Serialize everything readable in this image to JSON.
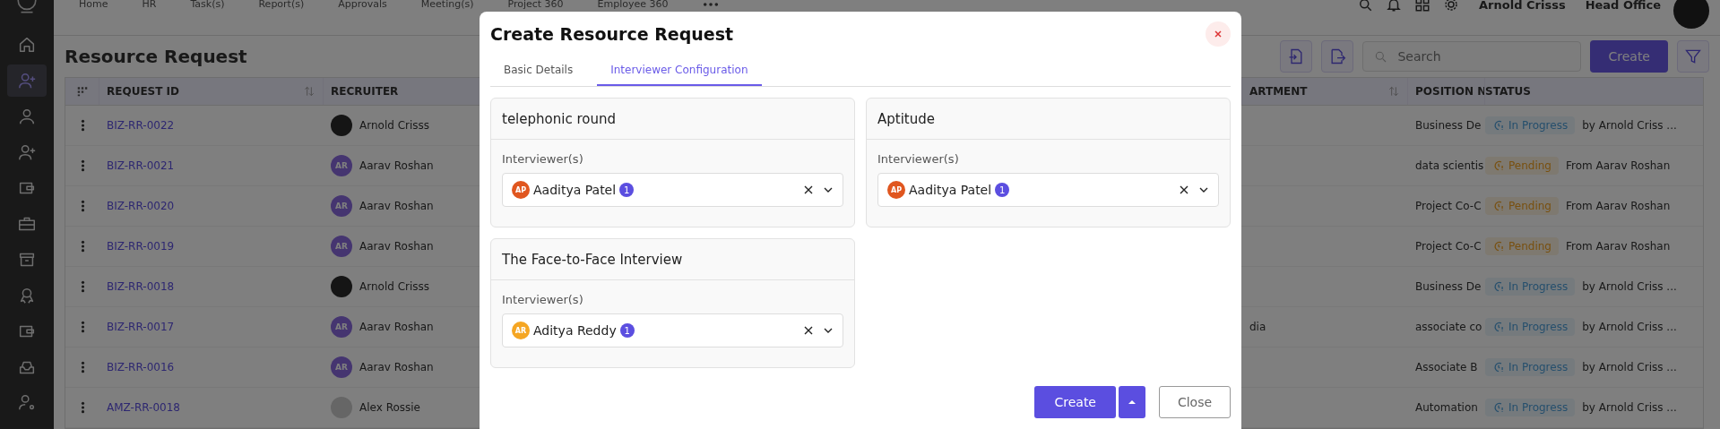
{
  "top_nav": {
    "items": [
      "Home",
      "HR",
      "Task(s)",
      "Report(s)",
      "Approvals",
      "Meeting(s)",
      "Project 360",
      "Employee 360"
    ]
  },
  "user": {
    "name": "Arnold Crisss",
    "office": "Head Office"
  },
  "sidebar": {
    "items": [
      {
        "kind": "home",
        "selected": false
      },
      {
        "kind": "user-plus",
        "selected": true
      },
      {
        "kind": "user",
        "selected": false
      },
      {
        "kind": "user-plus",
        "selected": false
      },
      {
        "kind": "wallet",
        "selected": false
      },
      {
        "kind": "briefcase",
        "selected": false
      },
      {
        "kind": "archive",
        "selected": false
      },
      {
        "kind": "award",
        "selected": false
      },
      {
        "kind": "wallet",
        "selected": false
      },
      {
        "kind": "tray",
        "selected": false
      },
      {
        "kind": "user-gear",
        "selected": false
      }
    ]
  },
  "page": {
    "title": "Resource Request",
    "search": {
      "placeholder": "Search"
    },
    "create_button": "Create"
  },
  "table": {
    "columns": [
      "REQUEST ID",
      "RECRUITER",
      "ARTMENT",
      "POSITION N",
      "STATUS"
    ],
    "rows": [
      {
        "request_id": "BIZ-RR-0022",
        "recruiter": "Arnold Crisss",
        "kind": "photo",
        "position": "Business De",
        "status": {
          "kind": "in_progress",
          "label": "In Progress"
        },
        "status_note": "by Arnold Criss ..."
      },
      {
        "request_id": "BIZ-RR-0021",
        "recruiter": "Aarav Roshan",
        "kind": "initials",
        "initials": "AR",
        "position": "data scientis",
        "status": {
          "kind": "pending",
          "label": "Pending"
        },
        "status_note": "From Aarav Roshan"
      },
      {
        "request_id": "BIZ-RR-0020",
        "recruiter": "Aarav Roshan",
        "kind": "initials",
        "initials": "AR",
        "position": "Project Co-C",
        "status": {
          "kind": "pending",
          "label": "Pending"
        },
        "status_note": "From Aarav Roshan"
      },
      {
        "request_id": "BIZ-RR-0019",
        "recruiter": "Aarav Roshan",
        "kind": "initials",
        "initials": "AR",
        "position": "Project Co-C",
        "status": {
          "kind": "pending",
          "label": "Pending"
        },
        "status_note": "From Aarav Roshan"
      },
      {
        "request_id": "BIZ-RR-0018",
        "recruiter": "Arnold Crisss",
        "kind": "photo",
        "position": "Business De",
        "status": {
          "kind": "in_progress",
          "label": "In Progress"
        },
        "status_note": "by Arnold Criss ..."
      },
      {
        "request_id": "BIZ-RR-0017",
        "recruiter": "Aarav Roshan",
        "kind": "initials",
        "initials": "AR",
        "department": "dia",
        "position": "associate co",
        "status": {
          "kind": "in_progress",
          "label": "In Progress"
        },
        "status_note": "by Arnold Criss ..."
      },
      {
        "request_id": "BIZ-RR-0016",
        "recruiter": "Aarav Roshan",
        "kind": "initials",
        "initials": "AR",
        "position": "Associate B",
        "status": {
          "kind": "in_progress",
          "label": "In Progress"
        },
        "status_note": "by Arnold Criss ..."
      },
      {
        "request_id": "AMZ-RR-0018",
        "recruiter": "Alex Rossie",
        "kind": "blank",
        "position": "Automation",
        "status": {
          "kind": "in_progress",
          "label": "In Progress"
        },
        "status_note": "by Arnold Criss ..."
      }
    ]
  },
  "modal": {
    "title": "Create Resource Request",
    "tabs": [
      {
        "label": "Basic Details",
        "selected": false
      },
      {
        "label": "Interviewer Configuration",
        "selected": true
      }
    ],
    "rounds": [
      {
        "title": "telephonic round",
        "field_label": "Interviewer(s)",
        "interviewer": {
          "initials": "AP",
          "name": "Aaditya Patel",
          "color": "#e0561f"
        },
        "count": "1"
      },
      {
        "title": "Aptitude",
        "field_label": "Interviewer(s)",
        "interviewer": {
          "initials": "AP",
          "name": "Aaditya Patel",
          "color": "#e0561f"
        },
        "count": "1"
      },
      {
        "title": "The Face-to-Face Interview",
        "field_label": "Interviewer(s)",
        "interviewer": {
          "initials": "AR",
          "name": "Aditya Reddy",
          "color": "#f5a623"
        },
        "count": "1"
      }
    ],
    "create_button": "Create",
    "close_button": "Close"
  }
}
